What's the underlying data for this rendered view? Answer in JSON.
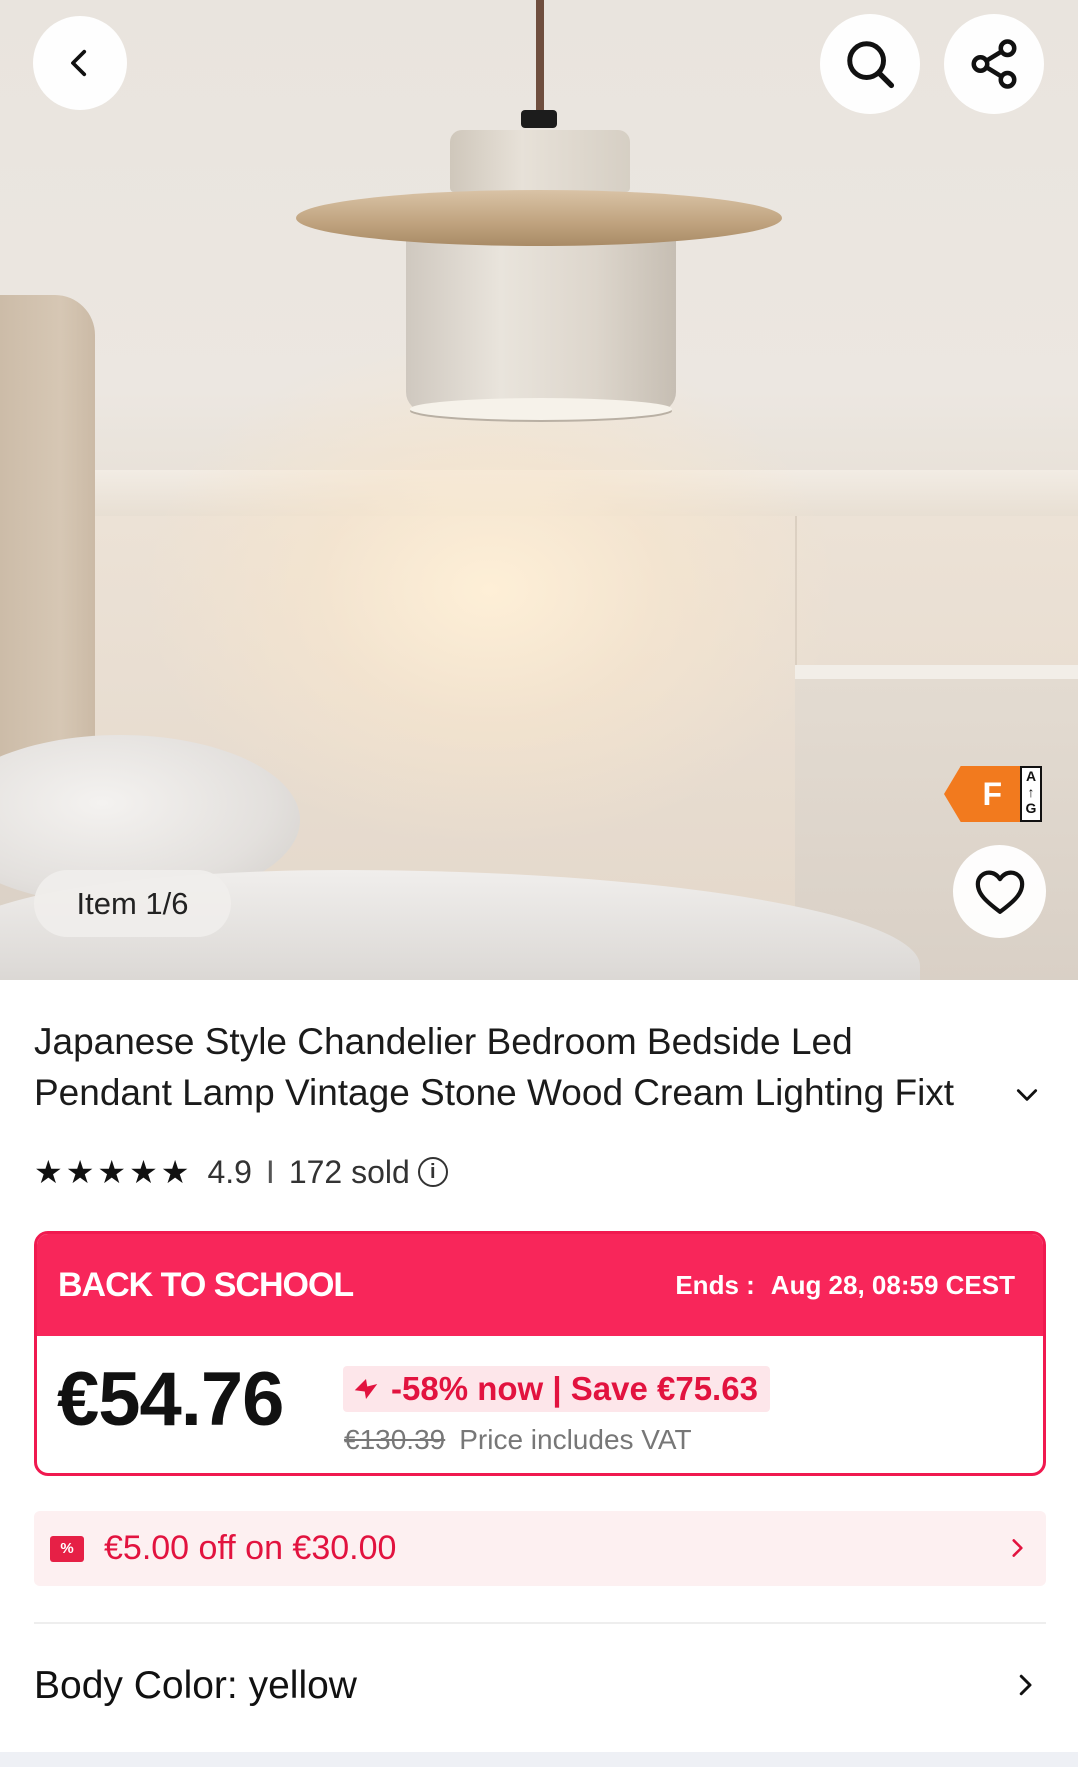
{
  "gallery": {
    "counter": "Item 1/6",
    "energy_class": "F",
    "energy_scale_top": "A",
    "energy_scale_arrow": "↑",
    "energy_scale_bottom": "G"
  },
  "product": {
    "title_line1": "Japanese Style Chandelier Bedroom Bedside Led",
    "title_line2": "Pendant Lamp Vintage Stone Wood Cream Lighting Fixt",
    "rating": "4.9",
    "rating_separator": "I",
    "sold": "172 sold",
    "stars_count": 5
  },
  "promo": {
    "title": "BACK TO SCHOOL",
    "ends_label": "Ends :",
    "ends_value": "Aug 28, 08:59 CEST",
    "price": "€54.76",
    "discount": "-58% now | Save €75.63",
    "old_price": "€130.39",
    "vat_note": "Price includes VAT"
  },
  "coupon": {
    "icon_text": "%",
    "text": "€5.00 off on €30.00"
  },
  "variant": {
    "label": "Body Color: yellow"
  },
  "colors": {
    "promo_red": "#f8265a",
    "discount_red": "#e2133f",
    "energy_orange": "#f27a1e"
  },
  "icons": {
    "back": "chevron-left-icon",
    "search": "search-icon",
    "share": "share-icon",
    "wishlist": "heart-icon",
    "info": "info-icon"
  }
}
